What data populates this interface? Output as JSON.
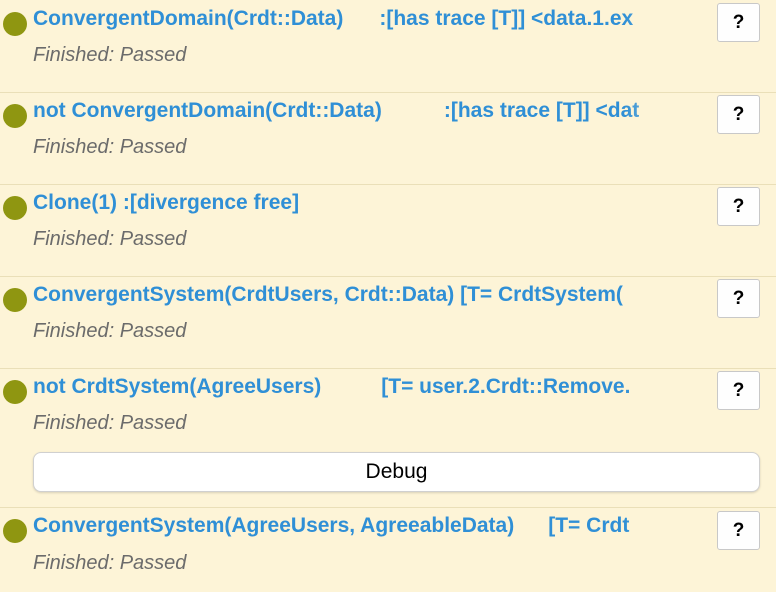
{
  "checks": [
    {
      "name": "ConvergentDomain(Crdt::Data)",
      "property": ":[has trace [T]] <data.1.ex",
      "status": "Finished: Passed",
      "help_label": "?"
    },
    {
      "name": "not ConvergentDomain(Crdt::Data)",
      "property": ":[has trace [T]] <dat",
      "status": "Finished: Passed",
      "help_label": "?"
    },
    {
      "name": "Clone(1) :[divergence free]",
      "property": "",
      "status": "Finished: Passed",
      "help_label": "?"
    },
    {
      "name": "ConvergentSystem(CrdtUsers, Crdt::Data) [T= CrdtSystem(",
      "property": "",
      "status": "Finished: Passed",
      "help_label": "?"
    },
    {
      "name": "not CrdtSystem(AgreeUsers)",
      "property": "[T= user.2.Crdt::Remove.",
      "status": "Finished: Passed",
      "help_label": "?",
      "debug_label": "Debug"
    },
    {
      "name": "ConvergentSystem(AgreeUsers, AgreeableData)",
      "property": "[T= Crdt",
      "status": "Finished: Passed",
      "help_label": "?"
    }
  ],
  "colors": {
    "background": "#fdf4d7",
    "status_dot": "#8f9611",
    "title": "#2f8fd6",
    "status_text": "#6b6b6b"
  },
  "icons": {
    "status": "status-dot-icon"
  }
}
